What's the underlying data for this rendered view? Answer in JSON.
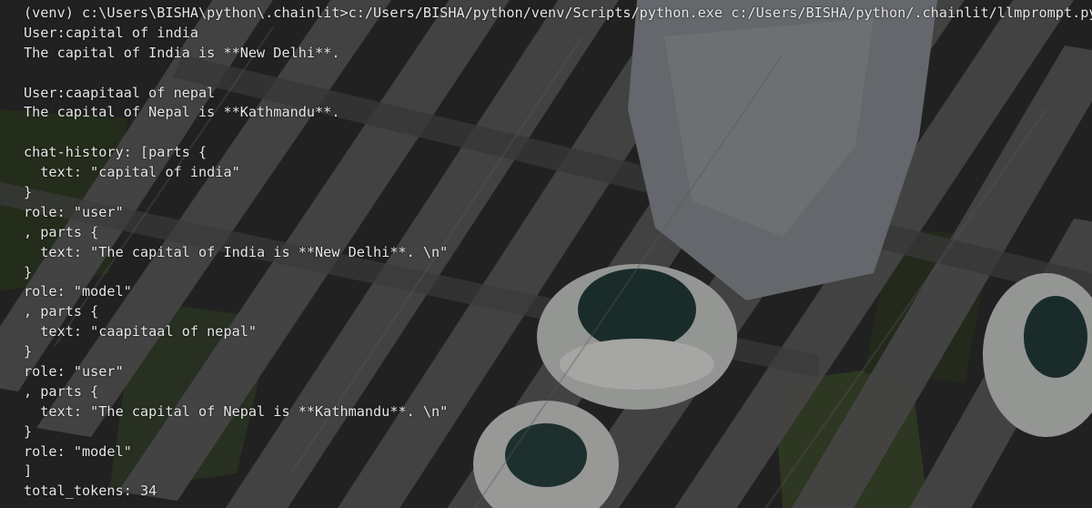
{
  "terminal": {
    "lines": [
      "(venv) c:\\Users\\BISHA\\python\\.chainlit>c:/Users/BISHA/python/venv/Scripts/python.exe c:/Users/BISHA/python/.chainlit/llmprompt.py",
      "User:capital of india",
      "The capital of India is **New Delhi**.",
      "",
      "User:caapitaal of nepal",
      "The capital of Nepal is **Kathmandu**.",
      "",
      "chat-history: [parts {",
      "  text: \"capital of india\"",
      "}",
      "role: \"user\"",
      ", parts {",
      "  text: \"The capital of India is **New Delhi**. \\n\"",
      "}",
      "role: \"model\"",
      ", parts {",
      "  text: \"caapitaal of nepal\"",
      "}",
      "role: \"user\"",
      ", parts {",
      "  text: \"The capital of Nepal is **Kathmandu**. \\n\"",
      "}",
      "role: \"model\"",
      "]",
      "total_tokens: 34"
    ]
  }
}
